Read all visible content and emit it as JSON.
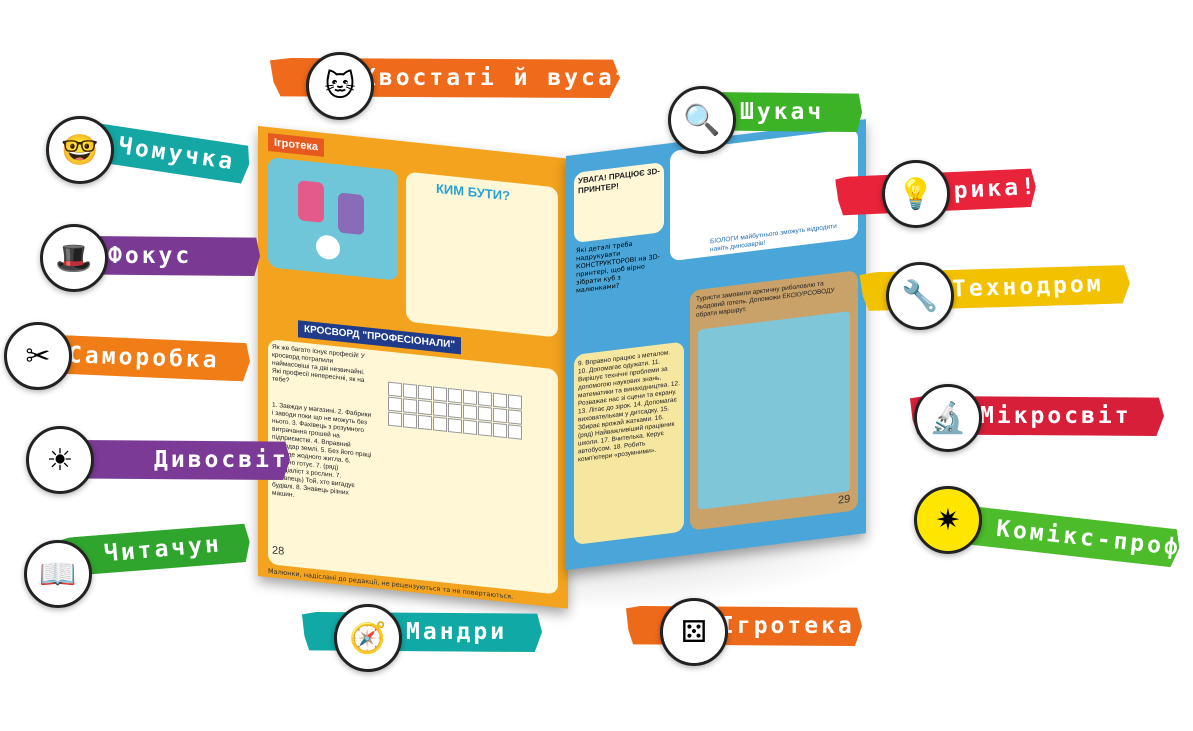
{
  "tags": {
    "khvostati": "Хвостаті й вусаті",
    "chomuchka": "Чомучка",
    "shukach": "Шукач",
    "evryka": "Еврика!",
    "fokus": "Фокус",
    "tekhnodrom": "Технодром",
    "samorobka": "Саморобка",
    "mikrosvit": "Мікросвіт",
    "dyvosvit": "Дивосвіт",
    "komiks": "Комікс-проф",
    "chytachun": "Читачун",
    "mandry": "Мандри",
    "ihroteka": "Ігротека"
  },
  "colors": {
    "khvostati": "#ef6a1a",
    "chomuchka": "#14a7a3",
    "shukach": "#3cb226",
    "evryka": "#e8233a",
    "fokus": "#7a3a93",
    "tekhnodrom": "#f2c200",
    "samorobka": "#f07d16",
    "mikrosvit": "#d81f3a",
    "dyvosvit": "#7b3a95",
    "komiks": "#4cbc2a",
    "chytachun": "#2fa52e",
    "mandry": "#10a9a6",
    "ihroteka": "#ee6a1b"
  },
  "icons": {
    "khvostati": "cat-icon",
    "chomuchka": "boy-glasses-icon",
    "shukach": "magnifier-boy-icon",
    "evryka": "lightbulb-icon",
    "fokus": "magic-hat-icon",
    "tekhnodrom": "wrench-icon",
    "samorobka": "scissors-icon",
    "mikrosvit": "microscope-icon",
    "dyvosvit": "sun-icon",
    "komiks": "comic-burst-icon",
    "chytachun": "reading-kid-icon",
    "mandry": "explorer-icon",
    "ihroteka": "dice-icon"
  },
  "magazine": {
    "left": {
      "section": "Ігротека",
      "kim_butu": "КИМ БУТИ?",
      "crossword_title": "КРОСВОРД \"ПРОФЕСІОНАЛИ\"",
      "intro": "Як же багато існує професій! У кросворд потрапили наймасовіші та дві незвичайні. Які професії непересічні, як на тебе?",
      "clues": "1. Завжди у магазині. 2. Фабрики і заводи поки що не можуть без нього. 3. Фахівець з розумного витрачання грошей на підприємстві. 4. Вправний господар землі. 5. Без його праці не буде жодного житла. 6. Смачно готує. 7. (ряд) Спеціаліст з рослин. 7. (стовпець) Той, хто вигадує будівлі. 8. Знавець різних машин.",
      "page_number": "28",
      "footer": "Малюнки, надіслані до редакції, не рецензуються та не повертаються."
    },
    "right": {
      "uvaga": "УВАГА! ПРАЦЮЄ 3D-ПРИНТЕР!",
      "printer_text": "Які деталі треба надрукувати КОНСТРУКТОРОВІ на 3D-принтері, щоб вірно зібрати куб з малюнками?",
      "biology": "БІОЛОГИ майбутнього зможуть відродити навіть динозаврів!",
      "maze_title": "Туристи замовили арктичну риболовлю та льодовий готель. Допоможи ЕКСКУРСОВОДУ обрати маршрут.",
      "clues": "9. Вправно працює з металом. 10. Допомагає одужати. 11. Вирішує технічні проблеми за допомогою наукових знань, математики та винахідництва. 12. Розважає нас зі сцени та екрану. 13. Літає до зірок. 14. Допомагає вихователькам у дитсадку. 15. Збирає врожай жатками. 16. (ряд) Найважливіший працівник школи. 17. Вчителька. Керує автобусом. 18. Робить комп'ютери «розумними».",
      "page_number": "29"
    }
  }
}
